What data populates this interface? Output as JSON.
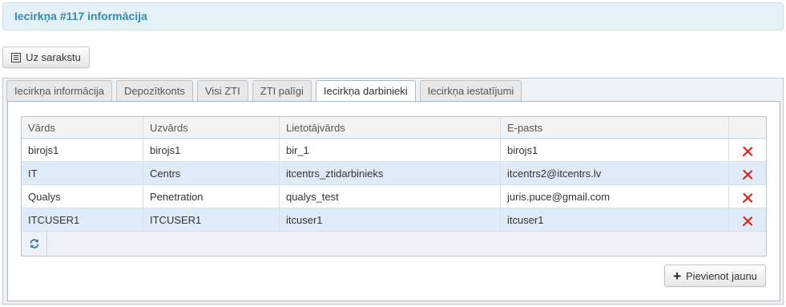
{
  "page": {
    "title": "Iecirkņa #117 informācija"
  },
  "toolbar": {
    "back_label": "Uz sarakstu",
    "back_icon": "list-icon"
  },
  "tabs": [
    {
      "label": "Iecirkņa informācija",
      "active": false
    },
    {
      "label": "Depozītkonts",
      "active": false
    },
    {
      "label": "Visi ZTI",
      "active": false
    },
    {
      "label": "ZTI palīgi",
      "active": false
    },
    {
      "label": "Iecirkņa darbinieki",
      "active": true
    },
    {
      "label": "Iecirkņa iestatījumi",
      "active": false
    }
  ],
  "grid": {
    "columns": [
      "Vārds",
      "Uzvārds",
      "Lietotājvārds",
      "E-pasts"
    ],
    "rows": [
      [
        "birojs1",
        "birojs1",
        "bir_1",
        "birojs1"
      ],
      [
        "IT",
        "Centrs",
        "itcentrs_ztidarbinieks",
        "itcentrs2@itcentrs.lv"
      ],
      [
        "Qualys",
        "Penetration",
        "qualys_test",
        "juris.puce@gmail.com"
      ],
      [
        "ITCUSER1",
        "ITCUSER1",
        "itcuser1",
        "itcuser1"
      ]
    ],
    "row_action_icon": "delete-icon",
    "footer_icon": "refresh-icon"
  },
  "actions": {
    "add_label": "Pievienot jaunu",
    "add_icon": "plus-icon"
  },
  "colors": {
    "accent": "#3a87ad",
    "header_bg": "#e5f1f8",
    "row_alt": "#dfebf8",
    "delete": "#d9261c"
  }
}
